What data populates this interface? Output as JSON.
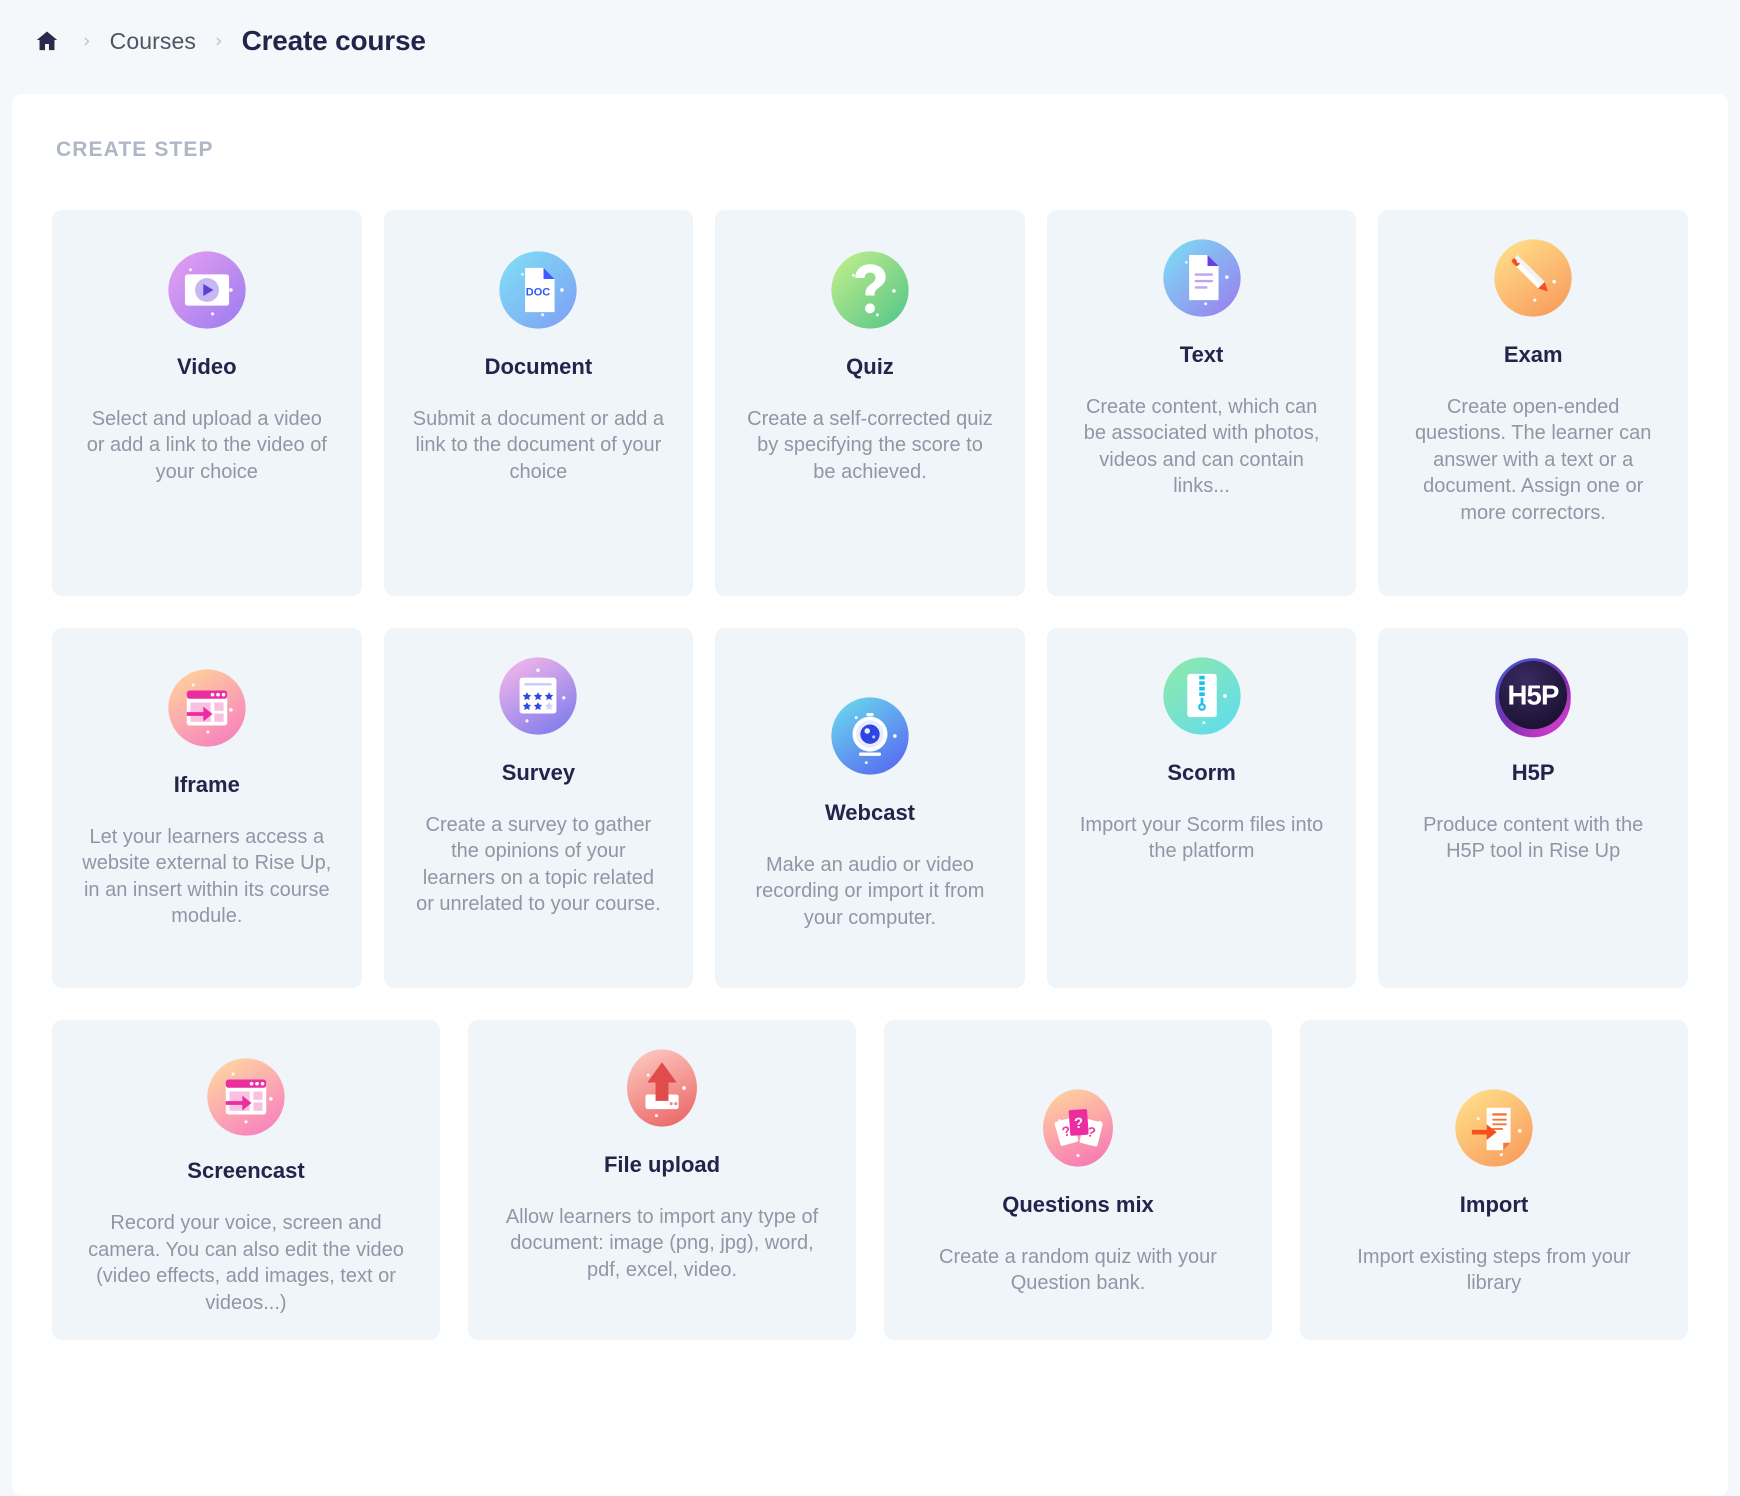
{
  "breadcrumb": {
    "home_icon": "home-icon",
    "separator": "›",
    "courses_label": "Courses",
    "current_label": "Create course"
  },
  "panel": {
    "section_title": "CREATE STEP"
  },
  "colors": {
    "page_bg": "#f5f8fb",
    "panel_bg": "#ffffff",
    "card_bg": "#f0f5fa",
    "title_text": "#23244a",
    "desc_text": "#8d97a6",
    "section_title": "#aeb7c6"
  },
  "rows": [
    {
      "cards": [
        {
          "icon": "video-play-icon",
          "title": "Video",
          "desc": "Select and upload a video or add a link to the video of your choice"
        },
        {
          "icon": "document-doc-icon",
          "title": "Document",
          "desc": "Submit a document or add a link to the document of your choice"
        },
        {
          "icon": "question-mark-icon",
          "title": "Quiz",
          "desc": "Create a self-corrected quiz by specifying the score to be achieved."
        },
        {
          "icon": "text-page-icon",
          "title": "Text",
          "desc": "Create content, which can be associated with photos, videos and can contain links..."
        },
        {
          "icon": "pencil-exam-icon",
          "title": "Exam",
          "desc": "Create open-ended questions. The learner can answer with a text or a document. Assign one or more correctors."
        }
      ]
    },
    {
      "cards": [
        {
          "icon": "iframe-window-icon",
          "title": "Iframe",
          "desc": "Let your learners access a website external to Rise Up, in an insert within its course module."
        },
        {
          "icon": "survey-stars-icon",
          "title": "Survey",
          "desc": "Create a survey to gather the opinions of your learners on a topic related or unrelated to your course."
        },
        {
          "icon": "webcam-icon",
          "title": "Webcast",
          "desc": "Make an audio or video recording or import it from your computer."
        },
        {
          "icon": "zip-archive-icon",
          "title": "Scorm",
          "desc": "Import your Scorm files into the platform"
        },
        {
          "icon": "h5p-logo-icon",
          "title": "H5P",
          "desc": "Produce content with the H5P tool in Rise Up"
        }
      ]
    },
    {
      "cards": [
        {
          "icon": "screencast-window-icon",
          "title": "Screencast",
          "desc": "Record your voice, screen and camera. You can also edit the video (video effects, add images, text or videos...)"
        },
        {
          "icon": "upload-arrow-icon",
          "title": "File upload",
          "desc": "Allow learners to import any type of document: image (png, jpg), word, pdf, excel, video."
        },
        {
          "icon": "question-cards-icon",
          "title": "Questions mix",
          "desc": "Create a random quiz with your Question bank."
        },
        {
          "icon": "import-arrow-icon",
          "title": "Import",
          "desc": "Import existing steps from your library"
        }
      ]
    }
  ]
}
